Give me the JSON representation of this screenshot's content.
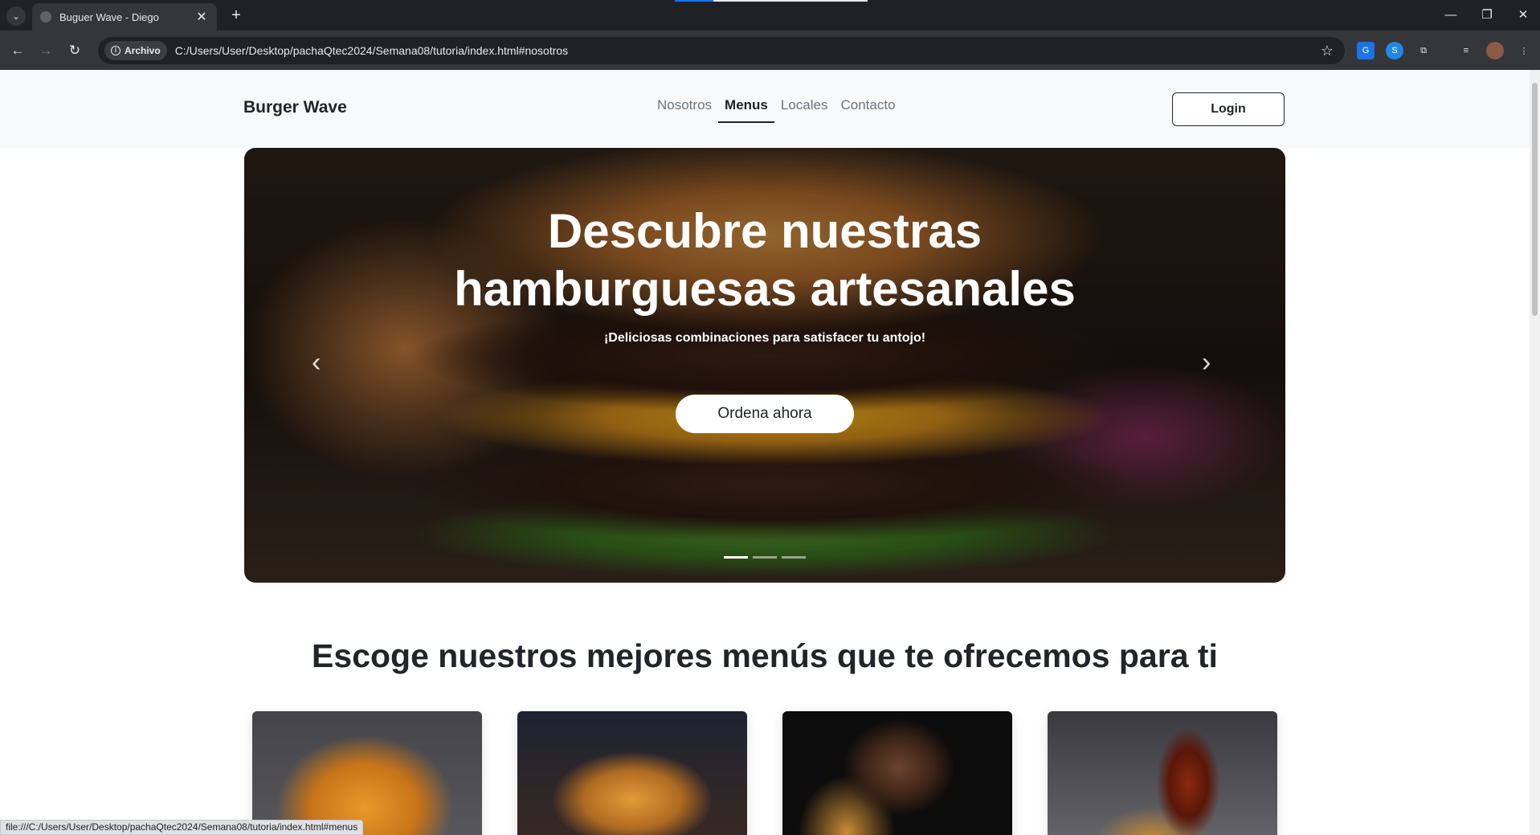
{
  "browser": {
    "tab_title": "Buguer Wave - Diego",
    "new_tab_label": "+",
    "close_tab_label": "✕",
    "security_chip": "Archivo",
    "url": "C:/Users/User/Desktop/pachaQtec2024/Semana08/tutoria/index.html#nosotros",
    "status_url": "file:///C:/Users/User/Desktop/pachaQtec2024/Semana08/tutoria/index.html#menus",
    "accent_color": "#1a73e8"
  },
  "navbar": {
    "brand": "Burger Wave",
    "links": [
      {
        "label": "Nosotros",
        "active": false
      },
      {
        "label": "Menus",
        "active": true
      },
      {
        "label": "Locales",
        "active": false
      },
      {
        "label": "Contacto",
        "active": false
      }
    ],
    "login_label": "Login"
  },
  "hero": {
    "title_line1": "Descubre nuestras",
    "title_line2": "hamburguesas artesanales",
    "subtitle": "¡Deliciosas combinaciones para satisfacer tu antojo!",
    "cta_label": "Ordena ahora",
    "prev_icon": "‹",
    "next_icon": "›",
    "slides_count": 3,
    "active_slide": 1
  },
  "menus_section": {
    "title": "Escoge nuestros mejores menús que te ofrecemos para ti"
  }
}
